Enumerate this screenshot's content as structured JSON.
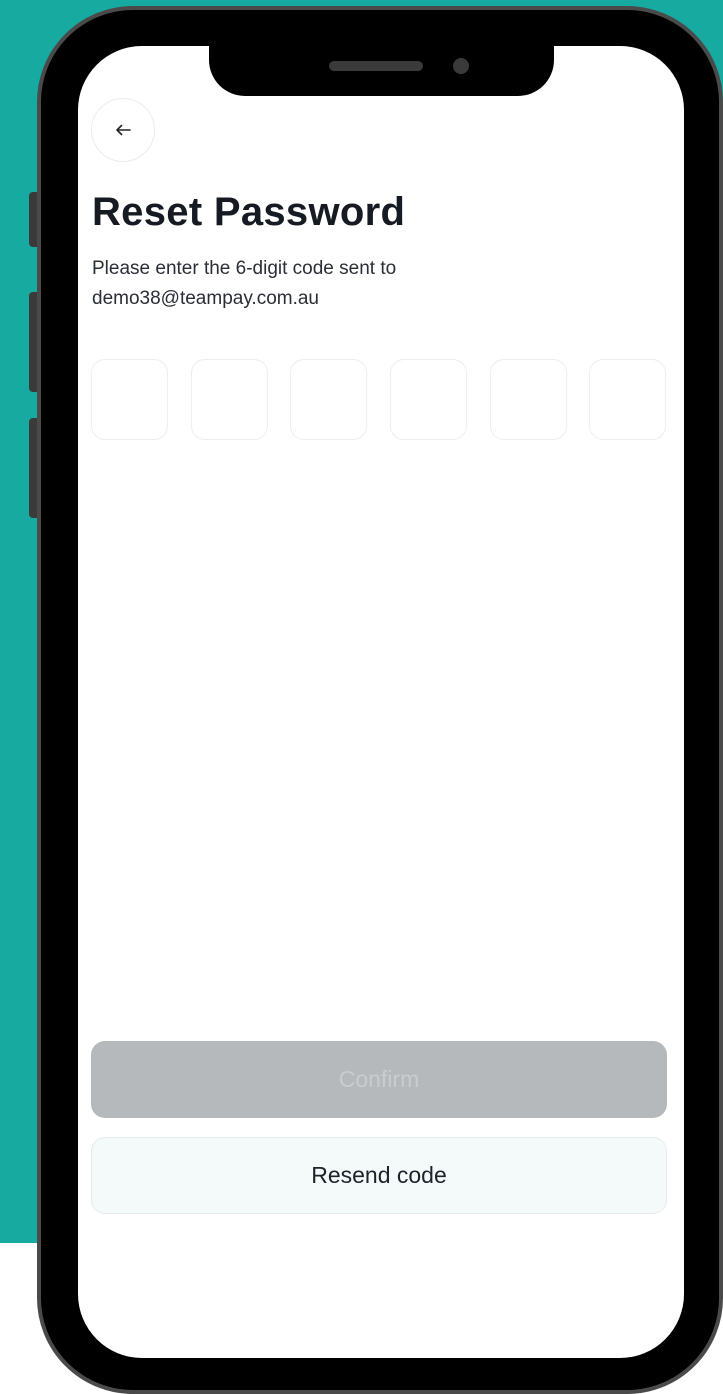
{
  "colors": {
    "background_accent": "#16aaa0",
    "confirm_disabled_bg": "#b5b9bc",
    "resend_bg": "#f4f9fa",
    "title_text": "#161a22"
  },
  "header": {
    "back_icon": "arrow-left-icon"
  },
  "reset": {
    "title": "Reset Password",
    "instruction": "Please enter the 6-digit code sent to",
    "email": "demo38@teampay.com.au",
    "code_digits": [
      "",
      "",
      "",
      "",
      "",
      ""
    ]
  },
  "actions": {
    "confirm_label": "Confirm",
    "confirm_enabled": false,
    "resend_label": "Resend code"
  }
}
